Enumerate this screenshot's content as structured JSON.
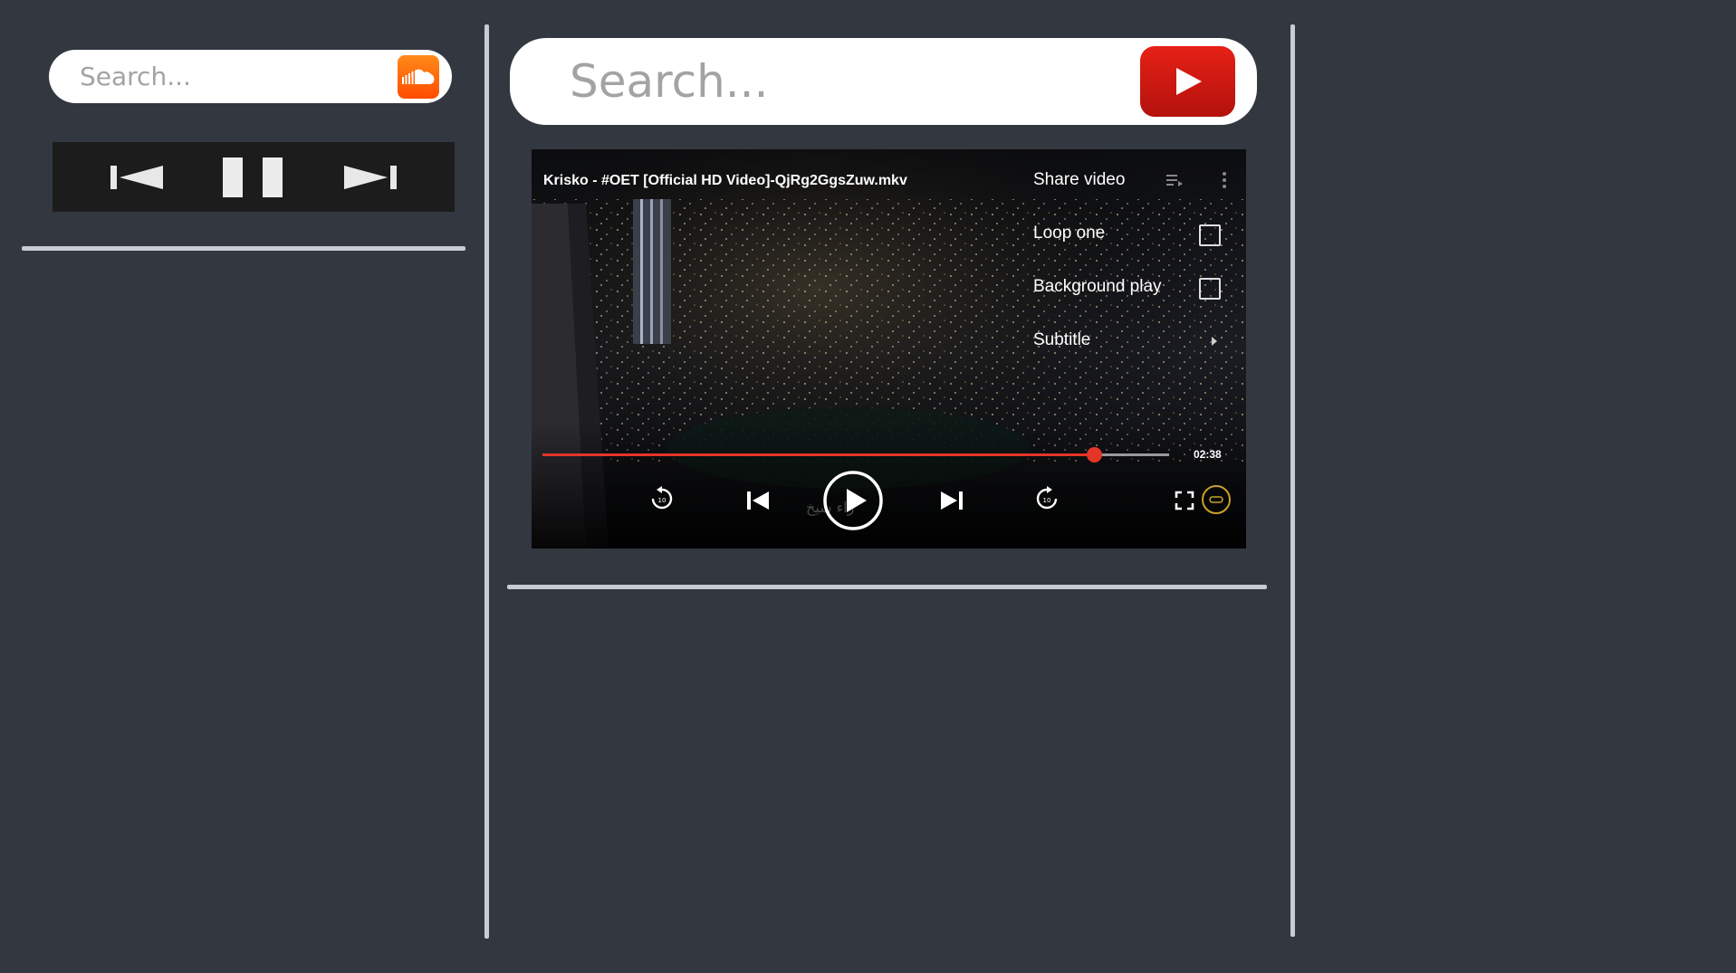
{
  "soundcloud": {
    "search_placeholder": "Search...",
    "search_icon": "soundcloud-logo-icon",
    "controls": {
      "prev_icon": "skip-previous-icon",
      "pause_icon": "pause-icon",
      "next_icon": "skip-next-icon"
    }
  },
  "youtube": {
    "search_placeholder": "Search...",
    "search_icon": "youtube-play-logo-icon"
  },
  "player": {
    "title": "Krisko - #OET [Official HD Video]-QjRg2GgsZuw.mkv",
    "menu": {
      "share_label": "Share video",
      "loop_label": "Loop one",
      "background_label": "Background play",
      "subtitle_label": "Subtitle"
    },
    "loop_checked": false,
    "background_checked": false,
    "progress_fraction": 0.88,
    "time_label": "02:38",
    "watermark": "ﺭﺍﺀ ﺷﻴﺦ"
  },
  "colors": {
    "background": "#333740",
    "progress": "#e53527",
    "youtube_red": "#e62117",
    "soundcloud_orange": "#ff5500"
  }
}
